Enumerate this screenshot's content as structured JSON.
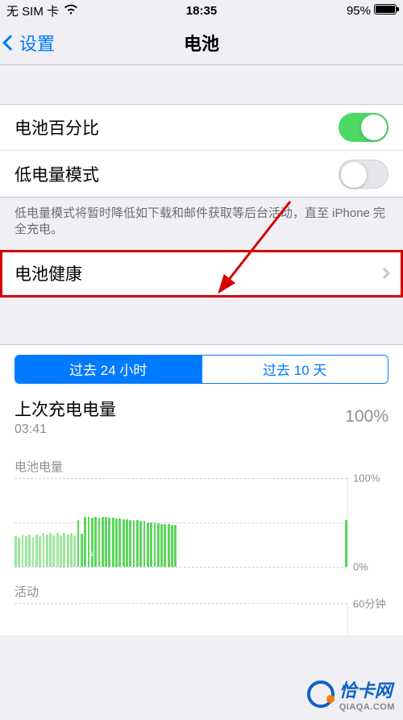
{
  "status": {
    "carrier": "无 SIM 卡",
    "time": "18:35",
    "battery_pct": "95%"
  },
  "nav": {
    "back_label": "设置",
    "title": "电池"
  },
  "rows": {
    "percentage_label": "电池百分比",
    "low_power_label": "低电量模式",
    "low_power_footer": "低电量模式将暂时降低如下载和邮件获取等后台活动，直至 iPhone 完全充电。",
    "health_label": "电池健康"
  },
  "toggles": {
    "percentage_on": true,
    "low_power_on": false
  },
  "segmented": {
    "tab_24h": "过去 24 小时",
    "tab_10d": "过去 10 天",
    "active": "24h"
  },
  "last_charge": {
    "title": "上次充电电量",
    "time": "03:41",
    "value": "100%"
  },
  "chart_labels": {
    "level_title": "电池电量",
    "activity_title": "活动",
    "y100": "100%",
    "y0": "0%",
    "y60min": "60分钟"
  },
  "chart_data": [
    {
      "type": "bar",
      "title": "电池电量",
      "ylabel": "%",
      "ylim": [
        0,
        100
      ],
      "values": [
        34,
        32,
        36,
        34,
        36,
        33,
        36,
        34,
        38,
        36,
        38,
        35,
        38,
        35,
        38,
        36,
        38,
        35,
        52,
        37,
        56,
        56,
        55,
        56,
        55,
        56,
        56,
        55,
        55,
        54,
        54,
        53,
        53,
        52,
        52,
        52,
        51,
        51,
        50,
        50,
        50,
        49,
        48,
        48,
        48,
        47,
        47,
        0,
        0,
        0,
        0,
        0,
        0,
        0,
        0,
        0,
        0,
        0,
        0,
        0,
        0,
        0,
        0,
        0,
        0,
        0,
        0,
        0,
        0,
        0,
        0,
        0,
        0,
        0,
        0,
        0,
        0,
        0,
        0,
        0,
        0,
        0,
        0,
        0,
        0,
        0,
        0,
        0,
        0,
        0,
        0,
        0,
        0,
        0,
        0,
        52
      ]
    },
    {
      "type": "bar",
      "title": "活动",
      "ylabel": "分钟",
      "ylim": [
        0,
        60
      ],
      "values": []
    }
  ],
  "watermark": {
    "name": "恰卡网",
    "url": "QIAQA.COM"
  }
}
